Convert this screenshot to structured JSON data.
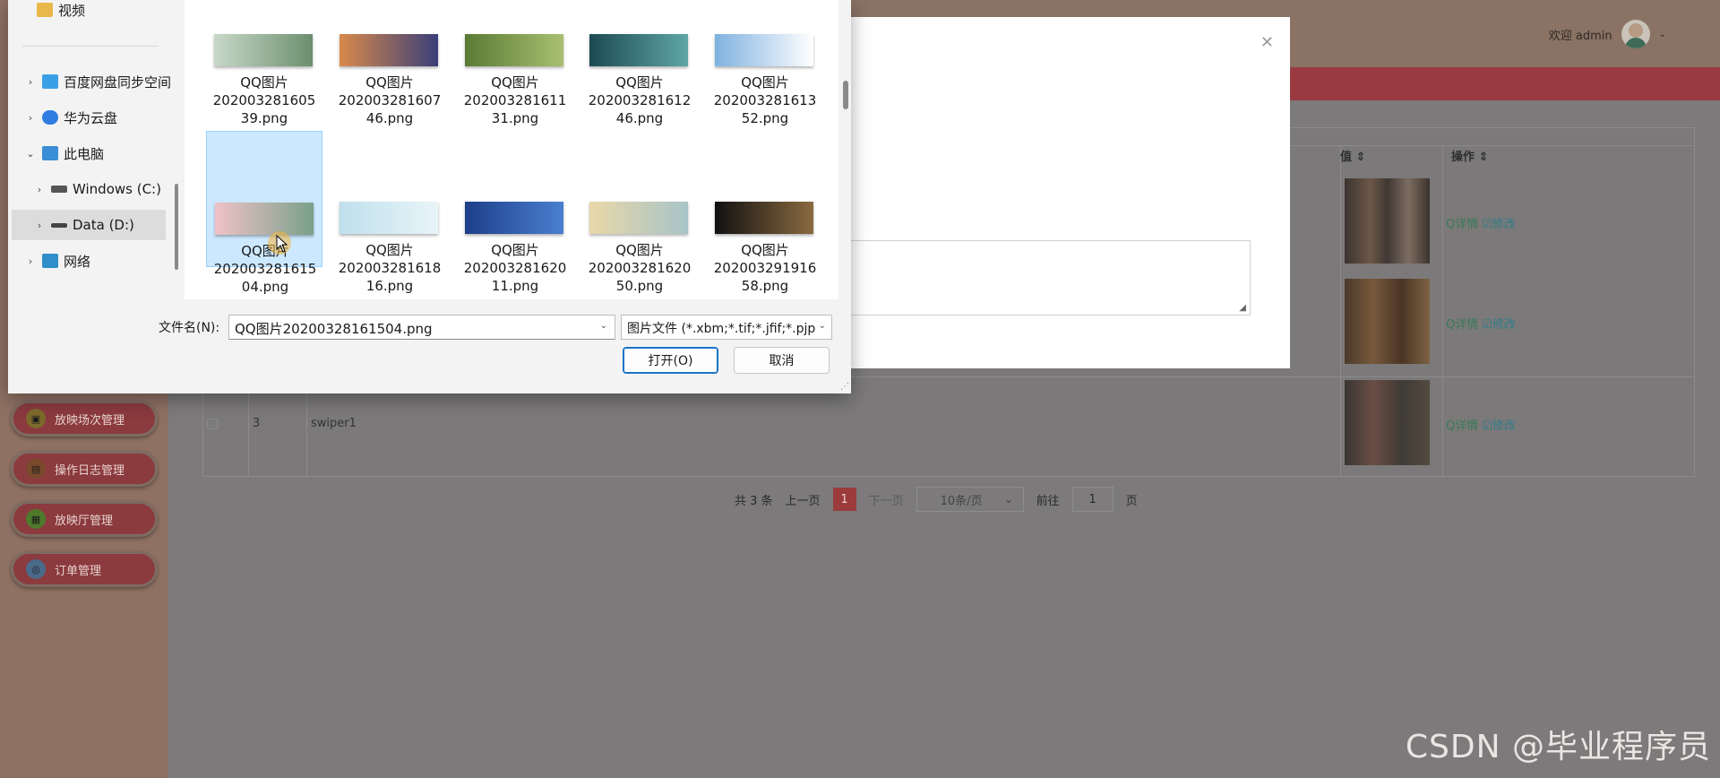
{
  "header": {
    "welcome": "欢迎 admin"
  },
  "sidebar": {
    "menu": [
      {
        "label": "放映场次管理",
        "icon": "film-icon"
      },
      {
        "label": "操作日志管理",
        "icon": "log-icon"
      },
      {
        "label": "放映厅管理",
        "icon": "hall-icon"
      },
      {
        "label": "订单管理",
        "icon": "order-icon"
      }
    ]
  },
  "table": {
    "columns": [
      "值",
      "操作"
    ],
    "rows": [
      {
        "index": "",
        "name": ""
      },
      {
        "index": "",
        "name": ""
      },
      {
        "index": "3",
        "name": "swiper1"
      }
    ],
    "actions": {
      "detail": "Q详情",
      "edit": "修改"
    }
  },
  "pagination": {
    "total": "共 3 条",
    "prev": "上一页",
    "current": "1",
    "next": "下一页",
    "page_size": "10条/页",
    "goto_label": "前往",
    "goto_value": "1",
    "page_unit": "页"
  },
  "watermark": "CSDN @毕业程序员",
  "file_dialog": {
    "nav": [
      {
        "label": "视频",
        "icon": "folder-icon",
        "color": "#e8b84a"
      },
      {
        "label": "百度网盘同步空间",
        "icon": "baidu-icon",
        "color": "#3aa0e6"
      },
      {
        "label": "华为云盘",
        "icon": "cloud-icon",
        "color": "#2f7de0"
      },
      {
        "label": "此电脑",
        "icon": "computer-icon",
        "color": "#3a8fd6"
      },
      {
        "label": "Windows (C:)",
        "icon": "drive-icon",
        "color": "#555555"
      },
      {
        "label": "Data (D:)",
        "icon": "drive-icon",
        "color": "#444444"
      },
      {
        "label": "网络",
        "icon": "network-icon",
        "color": "#2f8fc9"
      }
    ],
    "files": [
      {
        "name_lines": [
          "QQ图片",
          "202003281605",
          "39.png"
        ],
        "colors": [
          "#c8d8c8",
          "#6b8f6e"
        ]
      },
      {
        "name_lines": [
          "QQ图片",
          "202003281607",
          "46.png"
        ],
        "colors": [
          "#d9894a",
          "#3a3f7a"
        ]
      },
      {
        "name_lines": [
          "QQ图片",
          "202003281611",
          "31.png"
        ],
        "colors": [
          "#5a7a34",
          "#a8c070"
        ]
      },
      {
        "name_lines": [
          "QQ图片",
          "202003281612",
          "46.png"
        ],
        "colors": [
          "#1c4a52",
          "#5fa6a6"
        ]
      },
      {
        "name_lines": [
          "QQ图片",
          "202003281613",
          "52.png"
        ],
        "colors": [
          "#7fb2e0",
          "#ffffff"
        ]
      },
      {
        "name_lines": [
          "QQ图片",
          "202003281615",
          "04.png"
        ],
        "colors": [
          "#f0c2c8",
          "#7aa08a"
        ]
      },
      {
        "name_lines": [
          "QQ图片",
          "202003281618",
          "16.png"
        ],
        "colors": [
          "#bfe0ec",
          "#e8f4f8"
        ]
      },
      {
        "name_lines": [
          "QQ图片",
          "202003281620",
          "11.png"
        ],
        "colors": [
          "#1e3f8a",
          "#4a7fd0"
        ]
      },
      {
        "name_lines": [
          "QQ图片",
          "202003281620",
          "50.png"
        ],
        "colors": [
          "#e8d8a8",
          "#a8c4c8"
        ]
      },
      {
        "name_lines": [
          "QQ图片",
          "202003291916",
          "58.png"
        ],
        "colors": [
          "#111111",
          "#8a6a40"
        ]
      }
    ],
    "selected_index": 5,
    "filename_label": "文件名(N):",
    "filename_value": "QQ图片20200328161504.png",
    "filetype_value": "图片文件 (*.xbm;*.tif;*.jfif;*.pjp",
    "open_button": "打开(O)",
    "cancel_button": "取消"
  }
}
